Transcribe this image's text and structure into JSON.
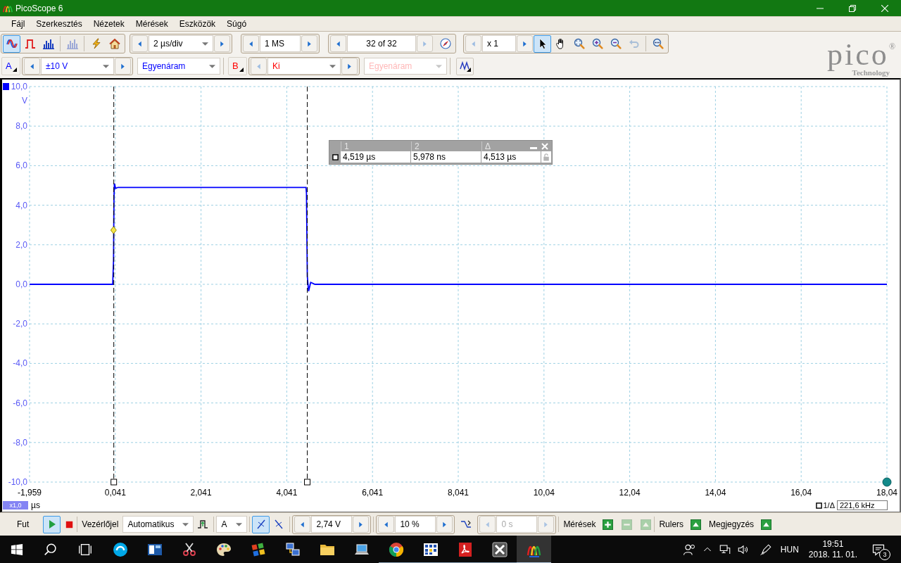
{
  "window": {
    "title": "PicoScope 6"
  },
  "menu": [
    "Fájl",
    "Szerkesztés",
    "Nézetek",
    "Mérések",
    "Eszközök",
    "Súgó"
  ],
  "toolbar": {
    "modes": [
      {
        "selected": true,
        "disabled": false
      },
      {
        "selected": false,
        "disabled": false
      },
      {
        "selected": false,
        "disabled": false
      },
      {
        "selected": false,
        "disabled": true
      }
    ],
    "timebase": "2 µs/div",
    "samples": "1 MS",
    "buffer": {
      "value": "32 of 32",
      "next_disabled": true
    },
    "zoom": {
      "value": "x 1",
      "prev_disabled": true
    },
    "tools": [
      {
        "selected": true,
        "disabled": false
      },
      {
        "selected": false,
        "disabled": false
      },
      {
        "selected": false,
        "disabled": false
      },
      {
        "selected": false,
        "disabled": false
      },
      {
        "selected": false,
        "disabled": false
      },
      {
        "selected": false,
        "disabled": true
      },
      {
        "selected": false,
        "disabled": false
      }
    ]
  },
  "logo": {
    "wordmark": "pico$^{®}$",
    "tagline": "Technology"
  },
  "channels": [
    {
      "label": "A",
      "color": "#0000ff",
      "range": "±10 V",
      "coupling": "Egyenáram",
      "enabled": true
    },
    {
      "label": "B",
      "color": "#ff0000",
      "range": "Ki",
      "coupling": "Egyenáram",
      "enabled": false
    }
  ],
  "scope": {
    "chart_data": {
      "type": "line",
      "xlabel": "µs",
      "ylabel": "V",
      "x": [
        -1.959,
        -0.02,
        0,
        0.01,
        0.02,
        0.05,
        0.1,
        4.49,
        4.5,
        4.52,
        4.55,
        4.6,
        4.7,
        18.041
      ],
      "series": [
        {
          "color": "#0000ff",
          "values": [
            0,
            0,
            1.2,
            4.4,
            5.1,
            4.85,
            4.9,
            4.9,
            4.6,
            0.4,
            -0.35,
            0.1,
            0,
            0
          ]
        }
      ],
      "xlim": [
        -1.959,
        18.041
      ],
      "ylim": [
        -10,
        10
      ],
      "xticks": [
        {
          "value": -1.959,
          "label": "-1,959"
        },
        {
          "value": 0.041,
          "label": "0,041"
        },
        {
          "value": 2.041,
          "label": "2,041"
        },
        {
          "value": 4.041,
          "label": "4,041"
        },
        {
          "value": 6.041,
          "label": "6,041"
        },
        {
          "value": 8.041,
          "label": "8,041"
        },
        {
          "value": 10.041,
          "label": "10,04"
        },
        {
          "value": 12.041,
          "label": "12,04"
        },
        {
          "value": 14.041,
          "label": "14,04"
        },
        {
          "value": 16.041,
          "label": "16,04"
        },
        {
          "value": 18.041,
          "label": "18,04"
        }
      ],
      "yticks": [
        {
          "value": 10,
          "label": "10,0"
        },
        {
          "value": 8,
          "label": "8,0"
        },
        {
          "value": 6,
          "label": "6,0"
        },
        {
          "value": 4,
          "label": "4,0"
        },
        {
          "value": 2,
          "label": "2,0"
        },
        {
          "value": 0,
          "label": "0,0"
        },
        {
          "value": -2,
          "label": "-2,0"
        },
        {
          "value": -4,
          "label": "-4,0"
        },
        {
          "value": -6,
          "label": "-6,0"
        },
        {
          "value": -8,
          "label": "-8,0"
        },
        {
          "value": -10,
          "label": "-10,0"
        }
      ],
      "grid": true,
      "ref_lines": [
        {
          "axis": "x",
          "value": 0.006
        },
        {
          "axis": "x",
          "value": 4.519
        }
      ]
    },
    "x_multiplier": "x1,0",
    "ruler_table": {
      "columns": [
        "1",
        "2",
        "Δ"
      ],
      "values": [
        "4,519 µs",
        "5,978 ns",
        "4,513 µs"
      ]
    },
    "ruler_readout": {
      "label": "1/Δ",
      "value": "221,6 kHz"
    }
  },
  "trigger_bar": {
    "run_label": "Fut",
    "running": true,
    "trigger_label": "Vezérlőjel",
    "mode": "Automatikus",
    "source": "A",
    "edges": [
      {
        "selected": true
      },
      {
        "selected": false
      }
    ],
    "threshold": "2,74 V",
    "pretrigger": "10 %",
    "delay": {
      "value": "0 s",
      "disabled": true
    },
    "measurements": {
      "label": "Mérések",
      "buttons": [
        {
          "disabled": false
        },
        {
          "disabled": true
        },
        {
          "disabled": true
        }
      ]
    },
    "rulers_label": "Rulers",
    "notes_label": "Megjegyzés"
  },
  "taskbar": {
    "apps": [
      {
        "running": false,
        "selected": false
      },
      {
        "running": false,
        "selected": false
      },
      {
        "running": false,
        "selected": false
      },
      {
        "running": false,
        "selected": false
      },
      {
        "running": false,
        "selected": false
      },
      {
        "running": false,
        "selected": false
      },
      {
        "running": false,
        "selected": false
      },
      {
        "running": false,
        "selected": false
      },
      {
        "running": true,
        "selected": false
      },
      {
        "running": true,
        "selected": false
      },
      {
        "running": true,
        "selected": false
      },
      {
        "running": true,
        "selected": false
      },
      {
        "running": true,
        "selected": true
      }
    ],
    "language": "HUN",
    "time": "19:51",
    "date": "2018. 11. 01.",
    "notifications": "3"
  }
}
